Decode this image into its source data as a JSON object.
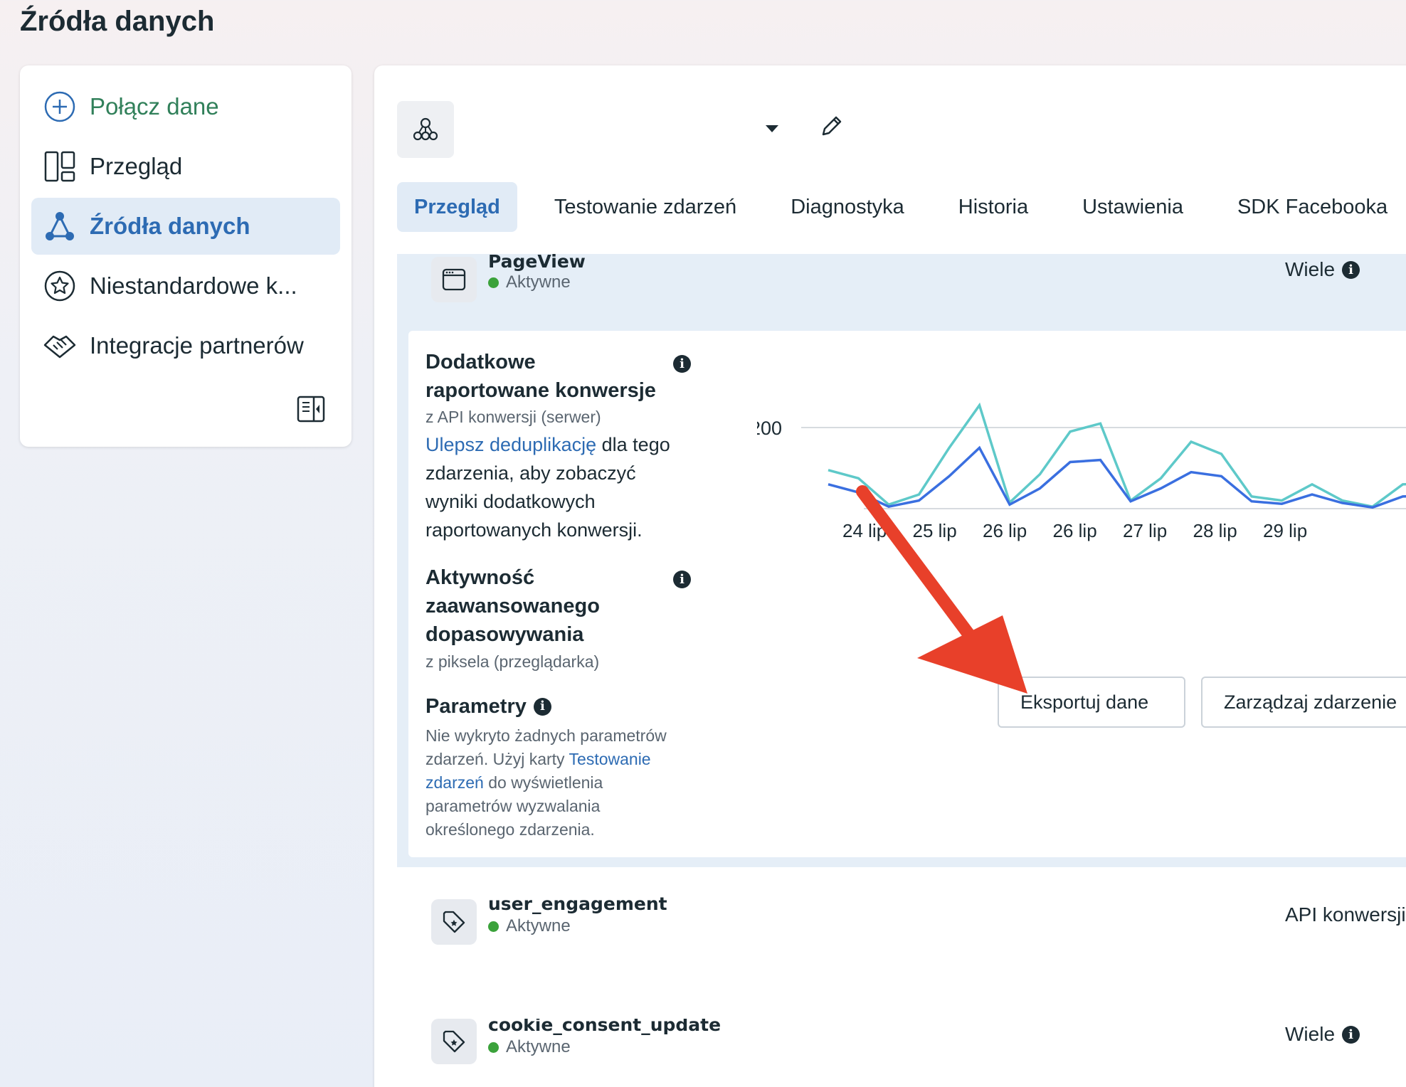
{
  "page": {
    "title": "Źródła danych"
  },
  "sidebar": {
    "items": [
      {
        "label": "Połącz dane",
        "icon": "plus-circle-icon"
      },
      {
        "label": "Przegląd",
        "icon": "layout-icon"
      },
      {
        "label": "Źródła danych",
        "icon": "data-sources-icon"
      },
      {
        "label": "Niestandardowe k...",
        "icon": "star-circle-icon"
      },
      {
        "label": "Integracje partnerów",
        "icon": "handshake-icon"
      }
    ],
    "collapse_icon": "sidebar-collapse-icon"
  },
  "tabs": [
    "Przegląd",
    "Testowanie zdarzeń",
    "Diagnostyka",
    "Historia",
    "Ustawienia",
    "SDK Facebooka"
  ],
  "events": {
    "pageview": {
      "name": "PageView",
      "status": "Aktywne",
      "source": "Wiele"
    },
    "user_engagement": {
      "name": "user_engagement",
      "status": "Aktywne",
      "source": "API konwersji"
    },
    "cookie": {
      "name": "cookie_consent_update",
      "status": "Aktywne",
      "source": "Wiele"
    }
  },
  "details": {
    "extra_heading_1": "Dodatkowe",
    "extra_heading_2": "raportowane konwersje",
    "extra_sub": "z API konwersji (serwer)",
    "extra_link": "Ulepsz deduplikację",
    "extra_text_1": " dla tego",
    "extra_text_2": "zdarzenia, aby zobaczyć",
    "extra_text_3": "wyniki dodatkowych",
    "extra_text_4": "raportowanych konwersji.",
    "amm_heading_1": "Aktywność",
    "amm_heading_2": "zaawansowanego",
    "amm_heading_3": "dopasowywania",
    "amm_sub": "z piksela (przeglądarka)",
    "params_heading": "Parametry",
    "params_text_1": "Nie wykryto żadnych parametrów",
    "params_text_2a": "zdarzeń. Użyj karty ",
    "params_link_1": "Testowanie",
    "params_link_2": "zdarzeń",
    "params_text_3b": " do wyświetlenia",
    "params_text_4": "parametrów wyzwalania",
    "params_text_5": "określonego zdarzenia.",
    "export_button": "Eksportuj dane",
    "manage_button": "Zarządzaj zdarzenie"
  },
  "chart_data": {
    "type": "line",
    "x": [
      "24 lip",
      "25 lip",
      "26 lip",
      "26 lip",
      "27 lip",
      "28 lip",
      "29 lip"
    ],
    "y_tick": "200",
    "colors": {
      "series_a": "#5ec9c9",
      "series_b": "#3a6fe0"
    },
    "series": [
      {
        "values": [
          95,
          75,
          10,
          35,
          150,
          255,
          15,
          85,
          190,
          210,
          20,
          75,
          165,
          135,
          30,
          20,
          60,
          20,
          5,
          60,
          62
        ]
      },
      {
        "values": [
          60,
          40,
          5,
          20,
          80,
          150,
          10,
          50,
          115,
          120,
          18,
          50,
          90,
          80,
          18,
          12,
          35,
          14,
          3,
          30,
          32
        ]
      }
    ]
  },
  "annotation": {
    "arrow_color": "#e8402a"
  }
}
